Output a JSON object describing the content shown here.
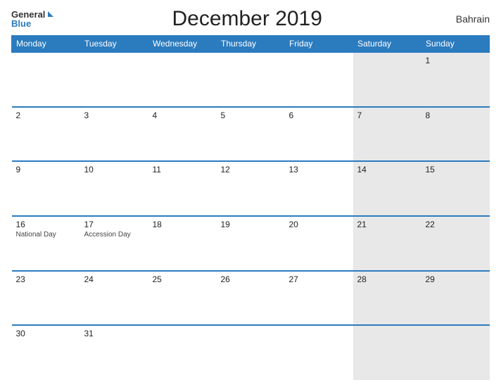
{
  "header": {
    "logo_general": "General",
    "logo_blue": "Blue",
    "title": "December 2019",
    "country": "Bahrain"
  },
  "days_of_week": [
    "Monday",
    "Tuesday",
    "Wednesday",
    "Thursday",
    "Friday",
    "Saturday",
    "Sunday"
  ],
  "weeks": [
    [
      {
        "date": "",
        "events": []
      },
      {
        "date": "",
        "events": []
      },
      {
        "date": "",
        "events": []
      },
      {
        "date": "",
        "events": []
      },
      {
        "date": "",
        "events": []
      },
      {
        "date": "",
        "events": []
      },
      {
        "date": "1",
        "events": []
      }
    ],
    [
      {
        "date": "2",
        "events": []
      },
      {
        "date": "3",
        "events": []
      },
      {
        "date": "4",
        "events": []
      },
      {
        "date": "5",
        "events": []
      },
      {
        "date": "6",
        "events": []
      },
      {
        "date": "7",
        "events": []
      },
      {
        "date": "8",
        "events": []
      }
    ],
    [
      {
        "date": "9",
        "events": []
      },
      {
        "date": "10",
        "events": []
      },
      {
        "date": "11",
        "events": []
      },
      {
        "date": "12",
        "events": []
      },
      {
        "date": "13",
        "events": []
      },
      {
        "date": "14",
        "events": []
      },
      {
        "date": "15",
        "events": []
      }
    ],
    [
      {
        "date": "16",
        "events": [
          "National Day"
        ]
      },
      {
        "date": "17",
        "events": [
          "Accession Day"
        ]
      },
      {
        "date": "18",
        "events": []
      },
      {
        "date": "19",
        "events": []
      },
      {
        "date": "20",
        "events": []
      },
      {
        "date": "21",
        "events": []
      },
      {
        "date": "22",
        "events": []
      }
    ],
    [
      {
        "date": "23",
        "events": []
      },
      {
        "date": "24",
        "events": []
      },
      {
        "date": "25",
        "events": []
      },
      {
        "date": "26",
        "events": []
      },
      {
        "date": "27",
        "events": []
      },
      {
        "date": "28",
        "events": []
      },
      {
        "date": "29",
        "events": []
      }
    ],
    [
      {
        "date": "30",
        "events": []
      },
      {
        "date": "31",
        "events": []
      },
      {
        "date": "",
        "events": []
      },
      {
        "date": "",
        "events": []
      },
      {
        "date": "",
        "events": []
      },
      {
        "date": "",
        "events": []
      },
      {
        "date": "",
        "events": []
      }
    ]
  ]
}
